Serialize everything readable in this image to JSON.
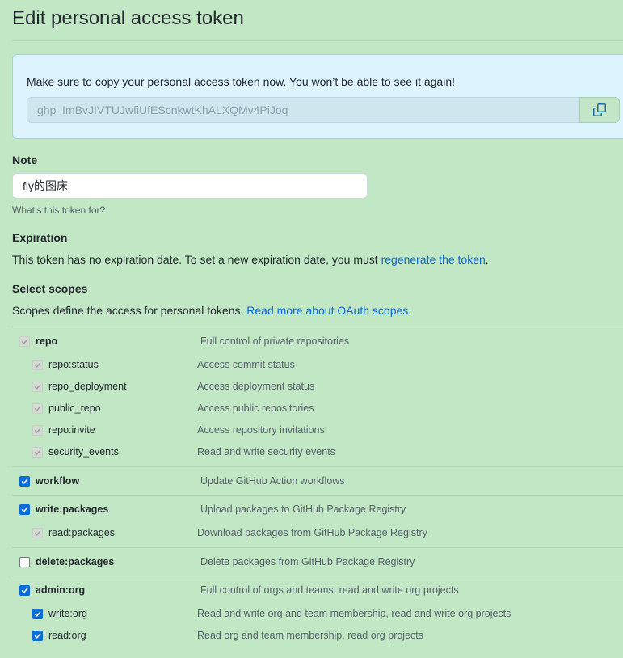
{
  "page_title": "Edit personal access token",
  "flash": {
    "message": "Make sure to copy your personal access token now. You won’t be able to see it again!",
    "token": "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",
    "copy_icon": "copy-icon"
  },
  "note": {
    "label": "Note",
    "value": "fly的图床",
    "hint": "What’s this token for?"
  },
  "expiration": {
    "label": "Expiration",
    "text": "This token has no expiration date. To set a new expiration date, you must ",
    "link": "regenerate the token",
    "suffix": "."
  },
  "scopes": {
    "label": "Select scopes",
    "text": "Scopes define the access for personal tokens. ",
    "link": "Read more about OAuth scopes.",
    "groups": [
      {
        "name": "repo",
        "desc": "Full control of private repositories",
        "state": "disabled",
        "children": [
          {
            "name": "repo:status",
            "desc": "Access commit status",
            "state": "disabled"
          },
          {
            "name": "repo_deployment",
            "desc": "Access deployment status",
            "state": "disabled"
          },
          {
            "name": "public_repo",
            "desc": "Access public repositories",
            "state": "disabled"
          },
          {
            "name": "repo:invite",
            "desc": "Access repository invitations",
            "state": "disabled"
          },
          {
            "name": "security_events",
            "desc": "Read and write security events",
            "state": "disabled"
          }
        ]
      },
      {
        "name": "workflow",
        "desc": "Update GitHub Action workflows",
        "state": "checked",
        "children": []
      },
      {
        "name": "write:packages",
        "desc": "Upload packages to GitHub Package Registry",
        "state": "checked",
        "children": [
          {
            "name": "read:packages",
            "desc": "Download packages from GitHub Package Registry",
            "state": "disabled"
          }
        ]
      },
      {
        "name": "delete:packages",
        "desc": "Delete packages from GitHub Package Registry",
        "state": "empty",
        "children": []
      },
      {
        "name": "admin:org",
        "desc": "Full control of orgs and teams, read and write org projects",
        "state": "checked",
        "children": [
          {
            "name": "write:org",
            "desc": "Read and write org and team membership, read and write org projects",
            "state": "checked"
          },
          {
            "name": "read:org",
            "desc": "Read org and team membership, read org projects",
            "state": "checked"
          }
        ]
      }
    ]
  },
  "colors": {
    "background": "#c1e7c5",
    "link": "#0969da",
    "checkbox": "#0b6cd8",
    "flash_bg": "#ddf4ff"
  }
}
